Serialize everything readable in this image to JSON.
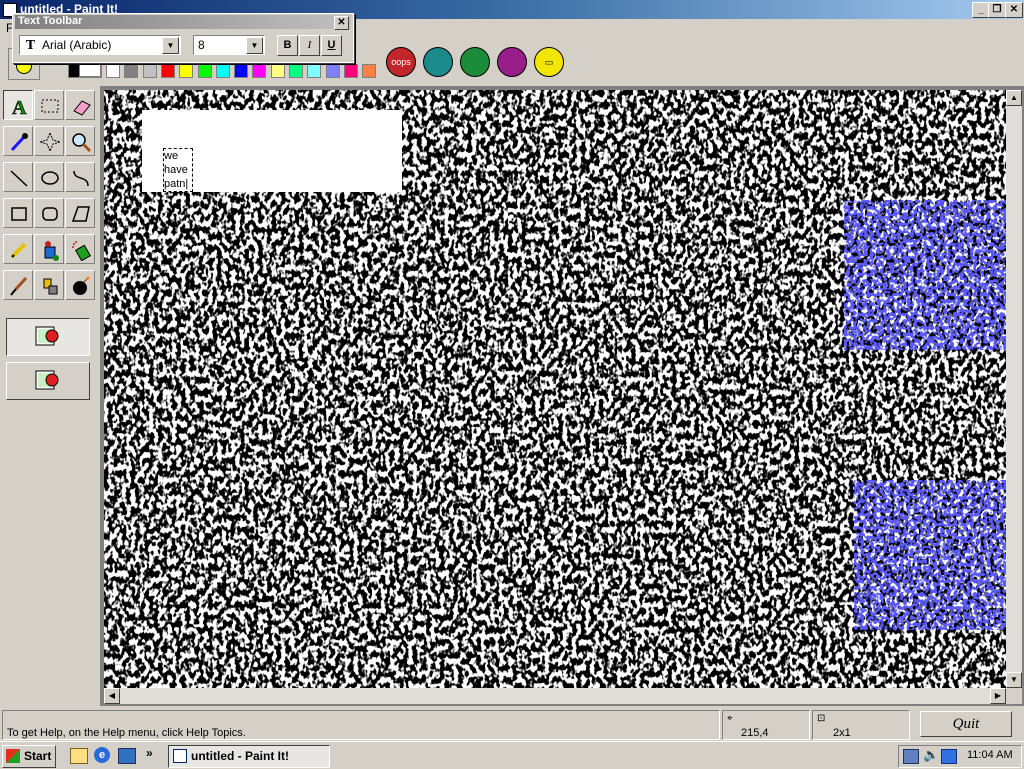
{
  "window": {
    "title": "untitled - Paint It!"
  },
  "menubar": {
    "first_item": "F"
  },
  "text_toolbar": {
    "title": "Text Toolbar",
    "font_name": "Arial (Arabic)",
    "font_size": "8",
    "bold_label": "B",
    "italic_label": "I",
    "underline_label": "U"
  },
  "action_buttons": [
    {
      "label": "oops",
      "color": "#c0262a"
    },
    {
      "label": "",
      "color": "#1b8a8a"
    },
    {
      "label": "",
      "color": "#1c8c3a"
    },
    {
      "label": "",
      "color": "#9a1e8a"
    },
    {
      "label": "",
      "color": "#f2e600"
    }
  ],
  "palette": [
    "#ffffff",
    "#808080",
    "#c0c0c0",
    "#ff0000",
    "#ffff00",
    "#00ff00",
    "#00ffff",
    "#0000ff",
    "#ff00ff",
    "#ffff80",
    "#00ff80",
    "#80ffff",
    "#8080ff",
    "#ff0080",
    "#ff8040"
  ],
  "canvas_text": {
    "line1": "we",
    "line2": "have",
    "line3": "patn|"
  },
  "status": {
    "help_text": "To get Help, on the Help menu, click Help Topics.",
    "coords": "215,4",
    "size": "2x1",
    "quit_label": "Quit"
  },
  "taskbar": {
    "start_label": "Start",
    "app_label": "untitled - Paint It!",
    "chevron": "»",
    "clock": "11:04 AM"
  },
  "colors": {
    "canvas_paint": "#000000",
    "spray_accent": "#1a1aff"
  }
}
